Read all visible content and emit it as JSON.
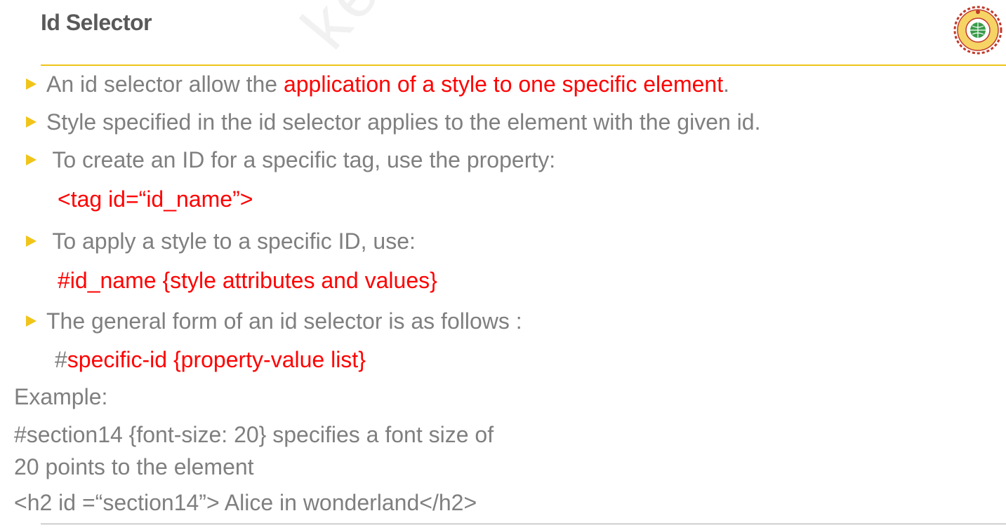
{
  "slide": {
    "title": "Id Selector",
    "watermark": "kerala"
  },
  "bullets": [
    {
      "pre": "An id selector allow the ",
      "highlight": "application of a style to one specific element",
      "post": "."
    },
    {
      "text": "Style specified in the id selector applies to the element with the given id."
    },
    {
      "text": " To create an ID for a specific tag, use the property:",
      "code": "<tag id=“id_name”>"
    },
    {
      "text": " To apply a style to a specific ID, use:",
      "code": "#id_name {style attributes and values}"
    },
    {
      "text": "The general form of an id selector is as follows :",
      "code_hash": "#",
      "code": "specific-id {property-value list}"
    }
  ],
  "example": {
    "label": "Example:",
    "line1": "#section14 {font-size: 20} specifies a font size of",
    "line2": "20 points to the element",
    "line3": "<h2 id =“section14”> Alice in wonderland</h2>"
  },
  "colors": {
    "accent": "#f0c419",
    "body_text": "#7f7f7f",
    "highlight": "#ff0000",
    "title": "#595959"
  },
  "icons": {
    "bullet": "triangle-bullet-icon",
    "logo": "college-emblem-icon"
  }
}
